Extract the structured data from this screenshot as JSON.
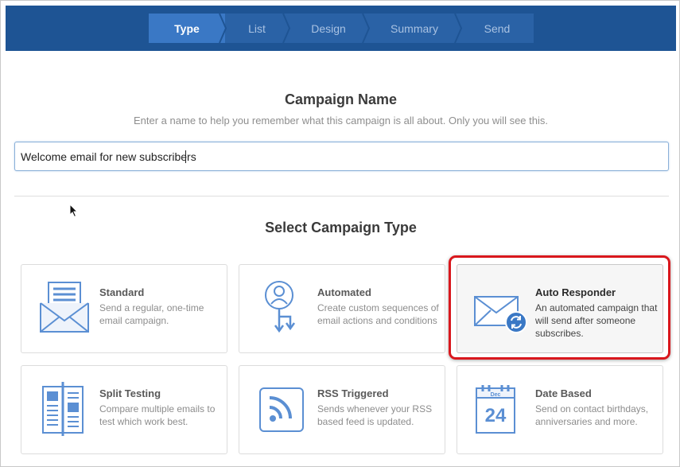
{
  "wizard": {
    "steps": [
      {
        "label": "Type",
        "active": true
      },
      {
        "label": "List",
        "active": false
      },
      {
        "label": "Design",
        "active": false
      },
      {
        "label": "Summary",
        "active": false
      },
      {
        "label": "Send",
        "active": false
      }
    ]
  },
  "campaign_name": {
    "heading": "Campaign Name",
    "help_text": "Enter a name to help you remember what this campaign is all about. Only you will see this.",
    "value": "Welcome email for new subscribers"
  },
  "campaign_type": {
    "heading": "Select Campaign Type",
    "options": [
      {
        "title": "Standard",
        "description": "Send a regular, one-time email campaign.",
        "icon": "envelope-letter-icon"
      },
      {
        "title": "Automated",
        "description": "Create custom sequences of email actions and conditions",
        "icon": "person-flow-icon"
      },
      {
        "title": "Auto Responder",
        "description": "An automated campaign that will send after someone subscribes.",
        "icon": "envelope-refresh-icon",
        "selected": true
      },
      {
        "title": "Split Testing",
        "description": "Compare multiple emails to test which work best.",
        "icon": "split-layout-icon"
      },
      {
        "title": "RSS Triggered",
        "description": "Sends whenever your RSS based feed is updated.",
        "icon": "rss-icon"
      },
      {
        "title": "Date Based",
        "description": "Send on contact birthdays, anniversaries and more.",
        "icon": "calendar-icon",
        "calendar_month": "Dec",
        "calendar_day": "24"
      }
    ]
  },
  "colors": {
    "header_bg": "#1e5494",
    "active_step": "#3a78c5",
    "icon_blue": "#5b8fd3",
    "highlight_red": "#d9171d"
  }
}
